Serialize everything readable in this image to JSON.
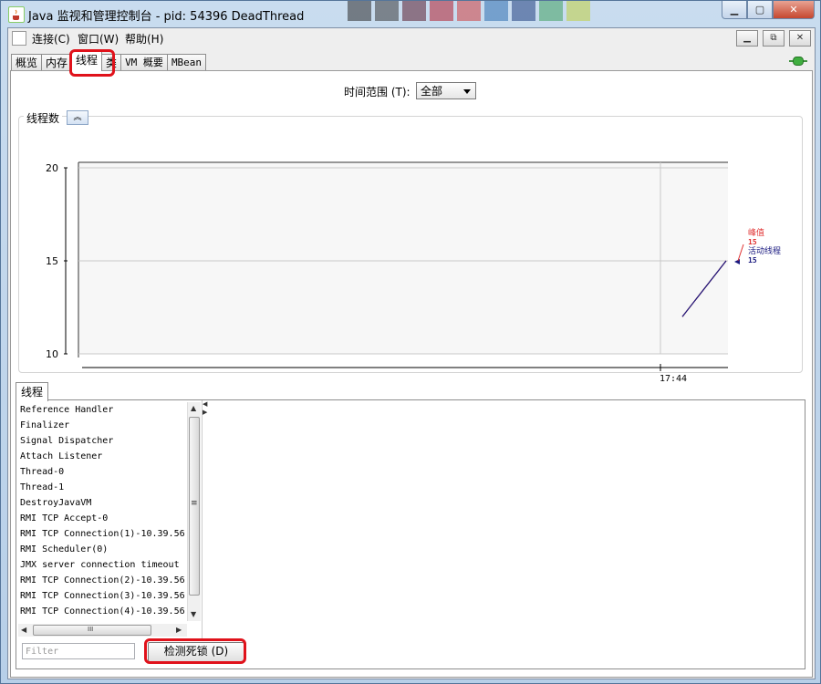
{
  "window": {
    "title": "Java 监视和管理控制台 - pid: 54396 DeadThread",
    "minimize_label": "▁",
    "maximize_label": "▢",
    "close_label": "✕"
  },
  "menubar": {
    "items": [
      {
        "label": "连接(C)"
      },
      {
        "label": "窗口(W)"
      },
      {
        "label": "帮助(H)"
      }
    ],
    "mdi_minimize": "▁",
    "mdi_restore": "⧉",
    "mdi_close": "✕"
  },
  "tabs": [
    {
      "label": "概览"
    },
    {
      "label": "内存"
    },
    {
      "label": "线程",
      "selected": true
    },
    {
      "label": "类"
    },
    {
      "label": "VM 概要"
    },
    {
      "label": "MBean"
    }
  ],
  "time_range": {
    "label": "时间范围 (T):",
    "selected": "全部"
  },
  "chart_panel": {
    "label": "线程数",
    "collapse_icon": "chevron-up-icon"
  },
  "chart_data": {
    "type": "line",
    "title": "线程数",
    "ylim": [
      10,
      20
    ],
    "y_ticks": [
      "20",
      "15",
      "10"
    ],
    "x_ticks": [
      "17:44"
    ],
    "series": [
      {
        "name": "峰值",
        "color": "#e03030",
        "values": [
          12,
          15
        ],
        "latest": "15"
      },
      {
        "name": "活动线程",
        "color": "#1a1a80",
        "values": [
          12,
          15
        ],
        "latest": "15"
      }
    ]
  },
  "threads_tab": {
    "label": "线程",
    "items": [
      "Reference Handler",
      "Finalizer",
      "Signal Dispatcher",
      "Attach Listener",
      "Thread-0",
      "Thread-1",
      "DestroyJavaVM",
      "RMI TCP Accept-0",
      "RMI TCP Connection(1)-10.39.56",
      "RMI Scheduler(0)",
      "JMX server connection timeout",
      "RMI TCP Connection(2)-10.39.56",
      "RMI TCP Connection(3)-10.39.56",
      "RMI TCP Connection(4)-10.39.56"
    ],
    "scrollbar_grip": "≡",
    "hscroll_grip": "III",
    "filter_placeholder": "Filter",
    "detect_deadlock": "检测死锁 (D)"
  }
}
